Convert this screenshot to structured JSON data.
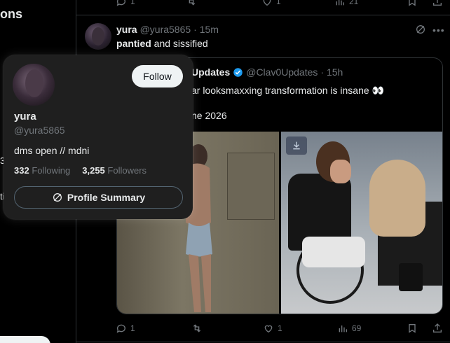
{
  "sidebar": {
    "nav_fragment": "ons",
    "frag_1": "3",
    "frag_2": "ti"
  },
  "top_actions": {
    "reply_count": "1",
    "like_count": "1",
    "views_count": "21"
  },
  "tweet": {
    "name": "yura",
    "handle": "@yura5865",
    "time": "· 15m",
    "text_bold": "pantied",
    "text_rest": " and sissified"
  },
  "quote": {
    "name": "Updates",
    "handle": "@Clav0Updates",
    "time": "· 15h",
    "text1": "ar looksmaxxing transformation is insane 👀",
    "text2": "ne 2026"
  },
  "bottom_actions": {
    "reply_count": "1",
    "retweet_count": "",
    "like_count": "1",
    "views_count": "69"
  },
  "hover_card": {
    "follow_label": "Follow",
    "name": "yura",
    "handle": "@yura5865",
    "bio": "dms open // mdni",
    "following_count": "332",
    "following_label": "Following",
    "followers_count": "3,255",
    "followers_label": "Followers",
    "summary_label": "Profile Summary"
  },
  "colors": {
    "background": "#000000",
    "card": "#1f1f1f",
    "muted": "#71767b",
    "verified": "#1d9bf0"
  },
  "icons": [
    "reply-icon",
    "retweet-icon",
    "like-icon",
    "views-icon",
    "bookmark-icon",
    "share-icon",
    "grok-icon",
    "more-icon",
    "verified-icon",
    "download-icon"
  ]
}
